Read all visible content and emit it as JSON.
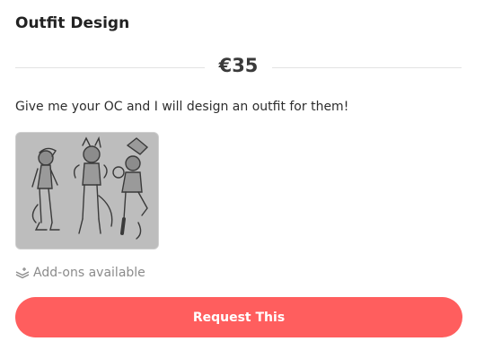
{
  "listing": {
    "title": "Outfit Design",
    "price": "€35",
    "description": "Give me your OC and I will design an outfit for them!",
    "image_icon": "sketch-thumbnail",
    "addons_icon": "layers-plus-icon",
    "addons_label": "Add-ons available",
    "button_label": "Request This",
    "accent_color": "#ff5e5e"
  }
}
